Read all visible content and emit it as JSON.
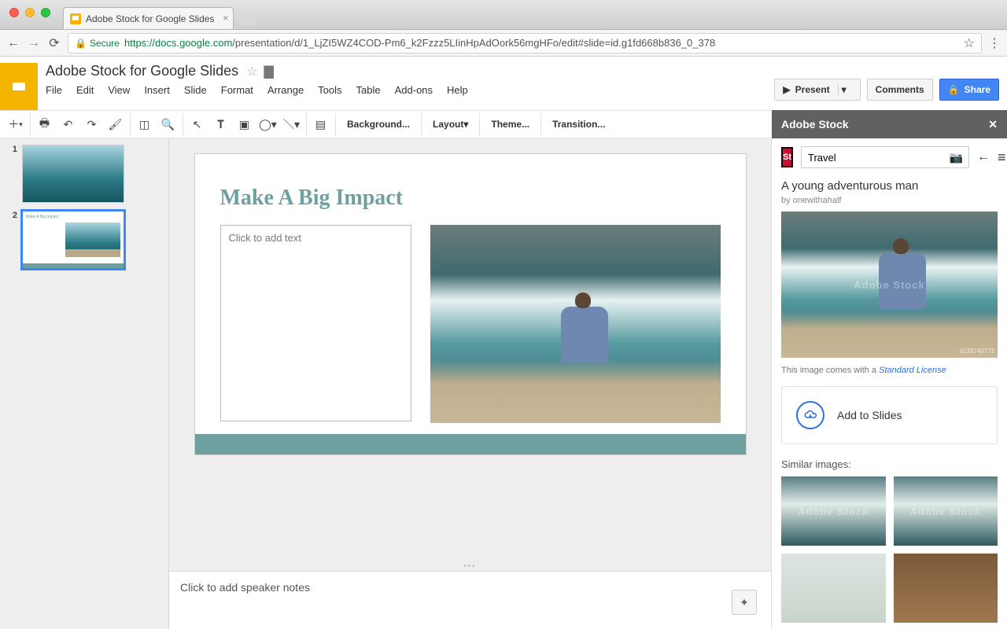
{
  "browser": {
    "tab_title": "Adobe Stock for Google Slides",
    "secure_label": "Secure",
    "url_host": "https://docs.google.com",
    "url_path": "/presentation/d/1_LjZI5WZ4COD-Pm6_k2Fzzz5LIinHpAdOork56mgHFo/edit#slide=id.g1fd668b836_0_378"
  },
  "doc": {
    "title": "Adobe Stock for Google Slides",
    "menus": [
      "File",
      "Edit",
      "View",
      "Insert",
      "Slide",
      "Format",
      "Arrange",
      "Tools",
      "Table",
      "Add-ons",
      "Help"
    ],
    "present_label": "Present",
    "comments_label": "Comments",
    "share_label": "Share"
  },
  "toolbar": {
    "background": "Background...",
    "layout": "Layout",
    "theme": "Theme...",
    "transition": "Transition..."
  },
  "thumbs": {
    "slide1_num": "1",
    "slide2_num": "2",
    "slide2_mini": "Make A Big Impact"
  },
  "slide": {
    "title": "Make A Big Impact",
    "placeholder": "Click to add text"
  },
  "notes": {
    "placeholder": "Click to add speaker notes"
  },
  "sidebar": {
    "title": "Adobe Stock",
    "search_value": "Travel",
    "image_title": "A young adventurous man",
    "image_by": "by onewithahalf",
    "license_prefix": "This image comes with a ",
    "license_link": "Standard License",
    "add_label": "Add to Slides",
    "similar_label": "Similar images:",
    "st_logo_text": "St",
    "watermark": "Adobe Stock",
    "preview_id": "#139740772"
  }
}
